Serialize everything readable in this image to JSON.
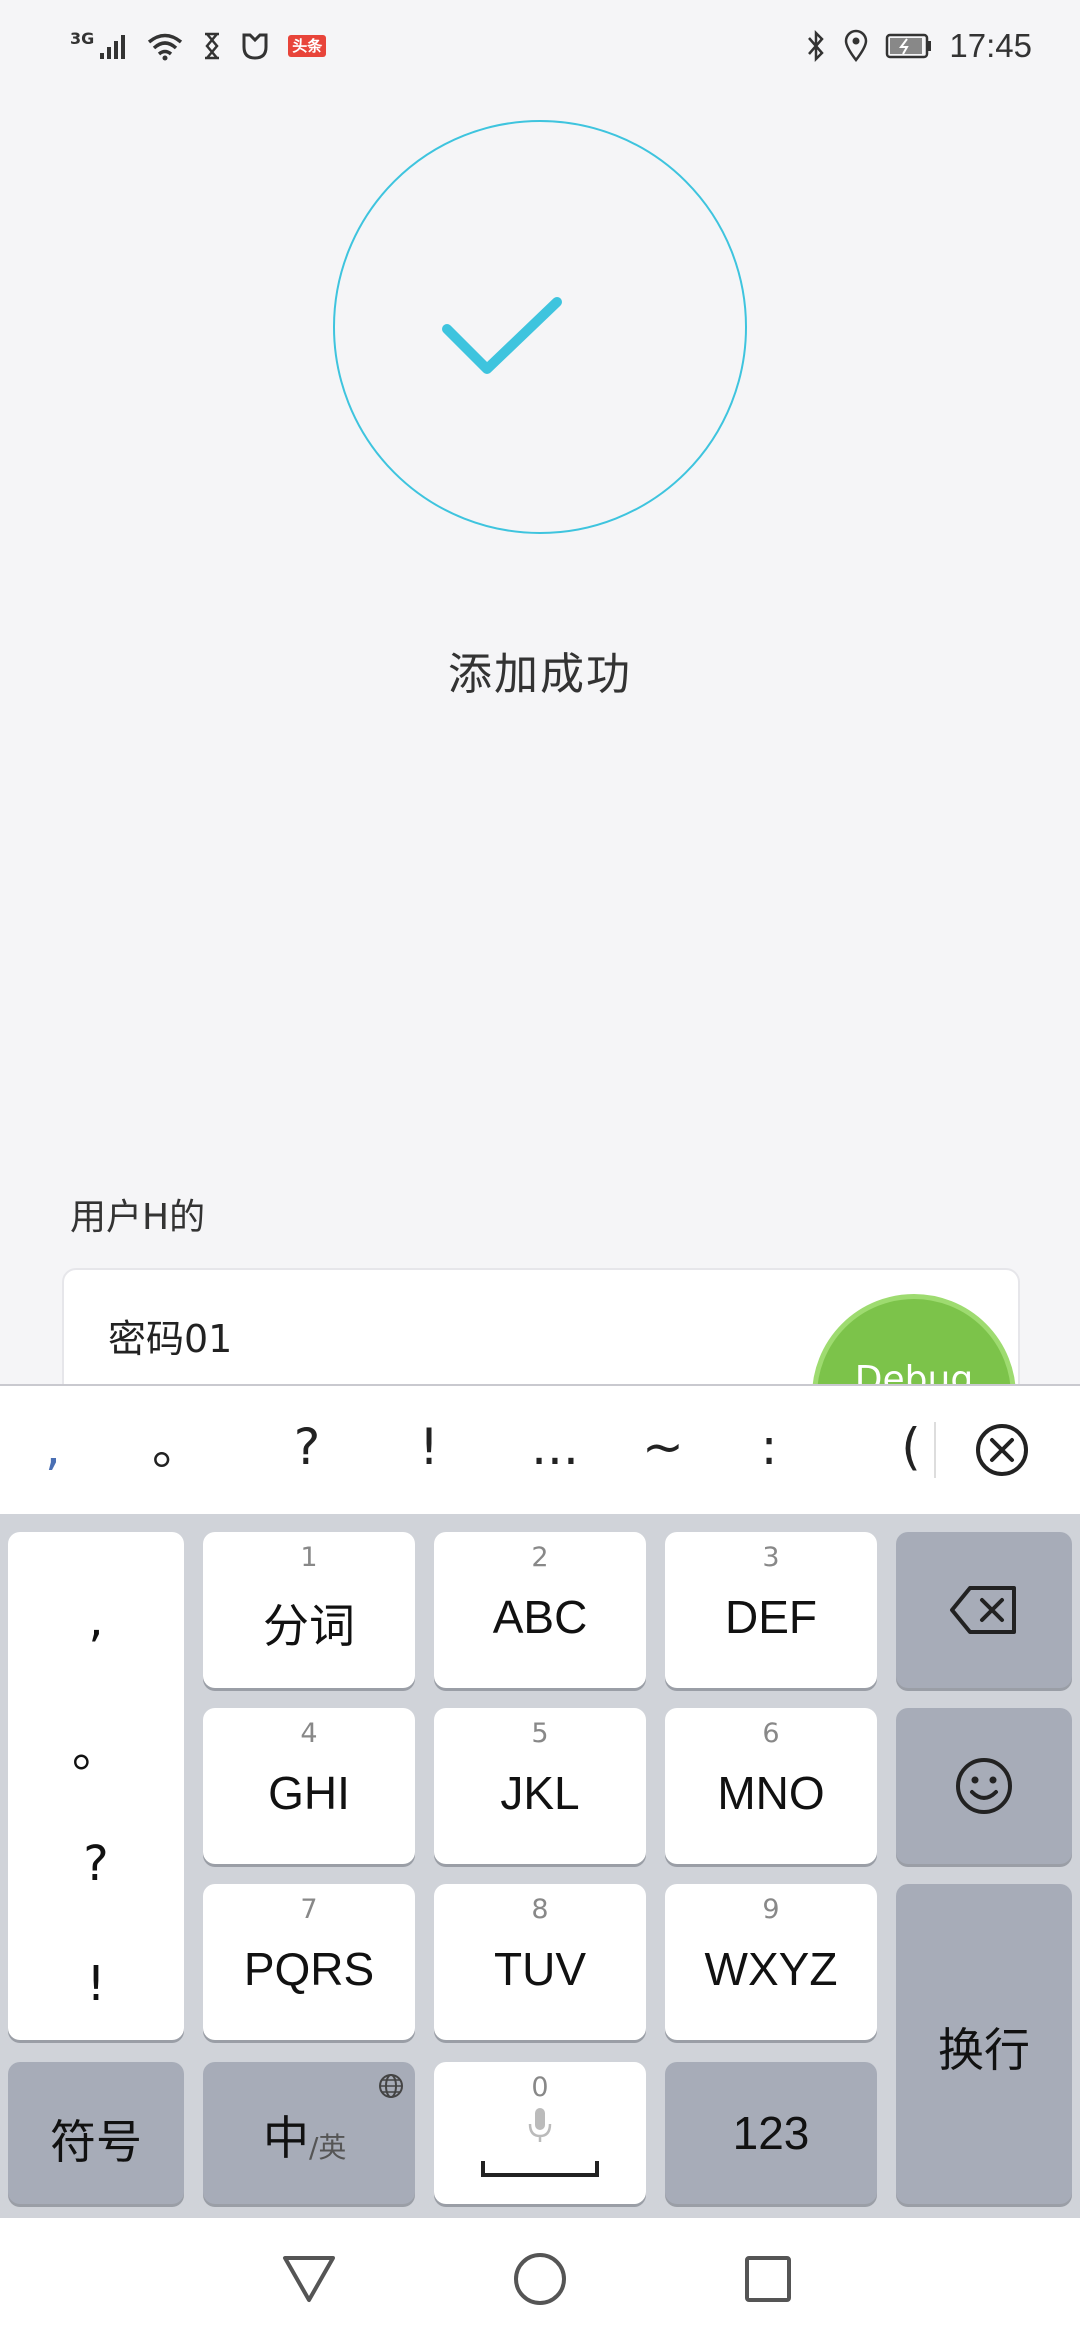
{
  "status_bar": {
    "network": "3G",
    "badge": "头条",
    "time": "17:45"
  },
  "success": {
    "message": "添加成功"
  },
  "form": {
    "user_label": "用户H的",
    "password_value": "密码01"
  },
  "debug_bubble": {
    "label": "Debug"
  },
  "keyboard": {
    "punctuation": [
      ",",
      "。",
      "?",
      "!",
      "...",
      "~",
      ":",
      "("
    ],
    "side_column": [
      ",",
      "。",
      "?",
      "!"
    ],
    "keys": {
      "k1": {
        "digit": "1",
        "label": "分词"
      },
      "k2": {
        "digit": "2",
        "label": "ABC"
      },
      "k3": {
        "digit": "3",
        "label": "DEF"
      },
      "k4": {
        "digit": "4",
        "label": "GHI"
      },
      "k5": {
        "digit": "5",
        "label": "JKL"
      },
      "k6": {
        "digit": "6",
        "label": "MNO"
      },
      "k7": {
        "digit": "7",
        "label": "PQRS"
      },
      "k8": {
        "digit": "8",
        "label": "TUV"
      },
      "k9": {
        "digit": "9",
        "label": "WXYZ"
      },
      "k0": {
        "digit": "0"
      }
    },
    "symbols_label": "符号",
    "lang_main": "中",
    "lang_alt": "/英",
    "numbers_label": "123",
    "enter_label": "换行"
  },
  "colors": {
    "accent": "#3ec4de",
    "debug_green": "#7cc34a",
    "keyboard_bg": "#d0d3d9",
    "function_key": "#a7acb8"
  }
}
